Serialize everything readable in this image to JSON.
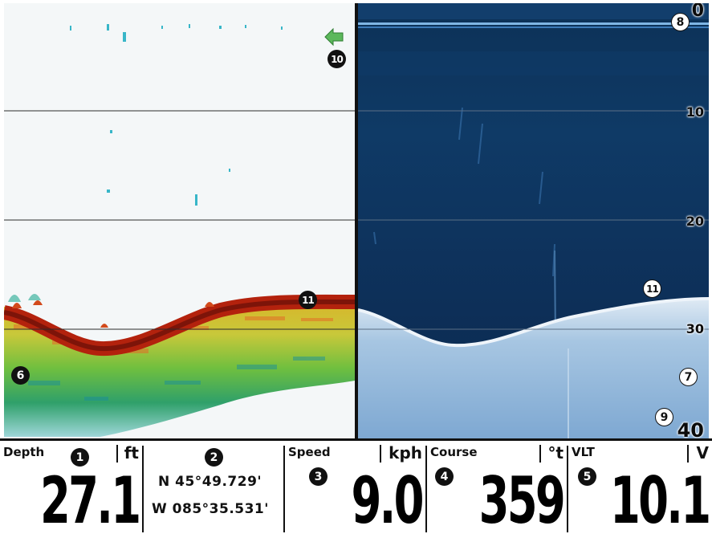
{
  "depth_scale": {
    "ticks": [
      "0",
      "10",
      "20",
      "30",
      "40"
    ]
  },
  "callouts": {
    "depth": "1",
    "position": "2",
    "speed": "3",
    "course": "4",
    "voltage": "5",
    "sonar_2d_bottom": "6",
    "down_imaging_bottom": "7",
    "surface_clutter": "8",
    "depth_scale": "9",
    "fish_arrow": "10",
    "bottom_return_2d": "11",
    "bottom_return_di": "11"
  },
  "colors": {
    "sonar_red": "#b3220d",
    "sonar_yellow": "#e6d23a",
    "sonar_green": "#3fb44a",
    "sonar_cyan": "#38b6c8",
    "di_water": "#0c2a4c",
    "di_bottom": "#aecde8",
    "fish_arrow": "#5cb85c"
  },
  "data_bar": {
    "depth": {
      "label": "Depth",
      "unit": "ft",
      "value": "27.1"
    },
    "position": {
      "lat": "N 45°49.729'",
      "lon": "W 085°35.531'"
    },
    "speed": {
      "label": "Speed",
      "unit": "kph",
      "value": "9.0"
    },
    "course": {
      "label": "Course",
      "unit": "°t",
      "value": "359"
    },
    "voltage": {
      "label": "VLT",
      "unit": "V",
      "value": "10.1"
    }
  }
}
